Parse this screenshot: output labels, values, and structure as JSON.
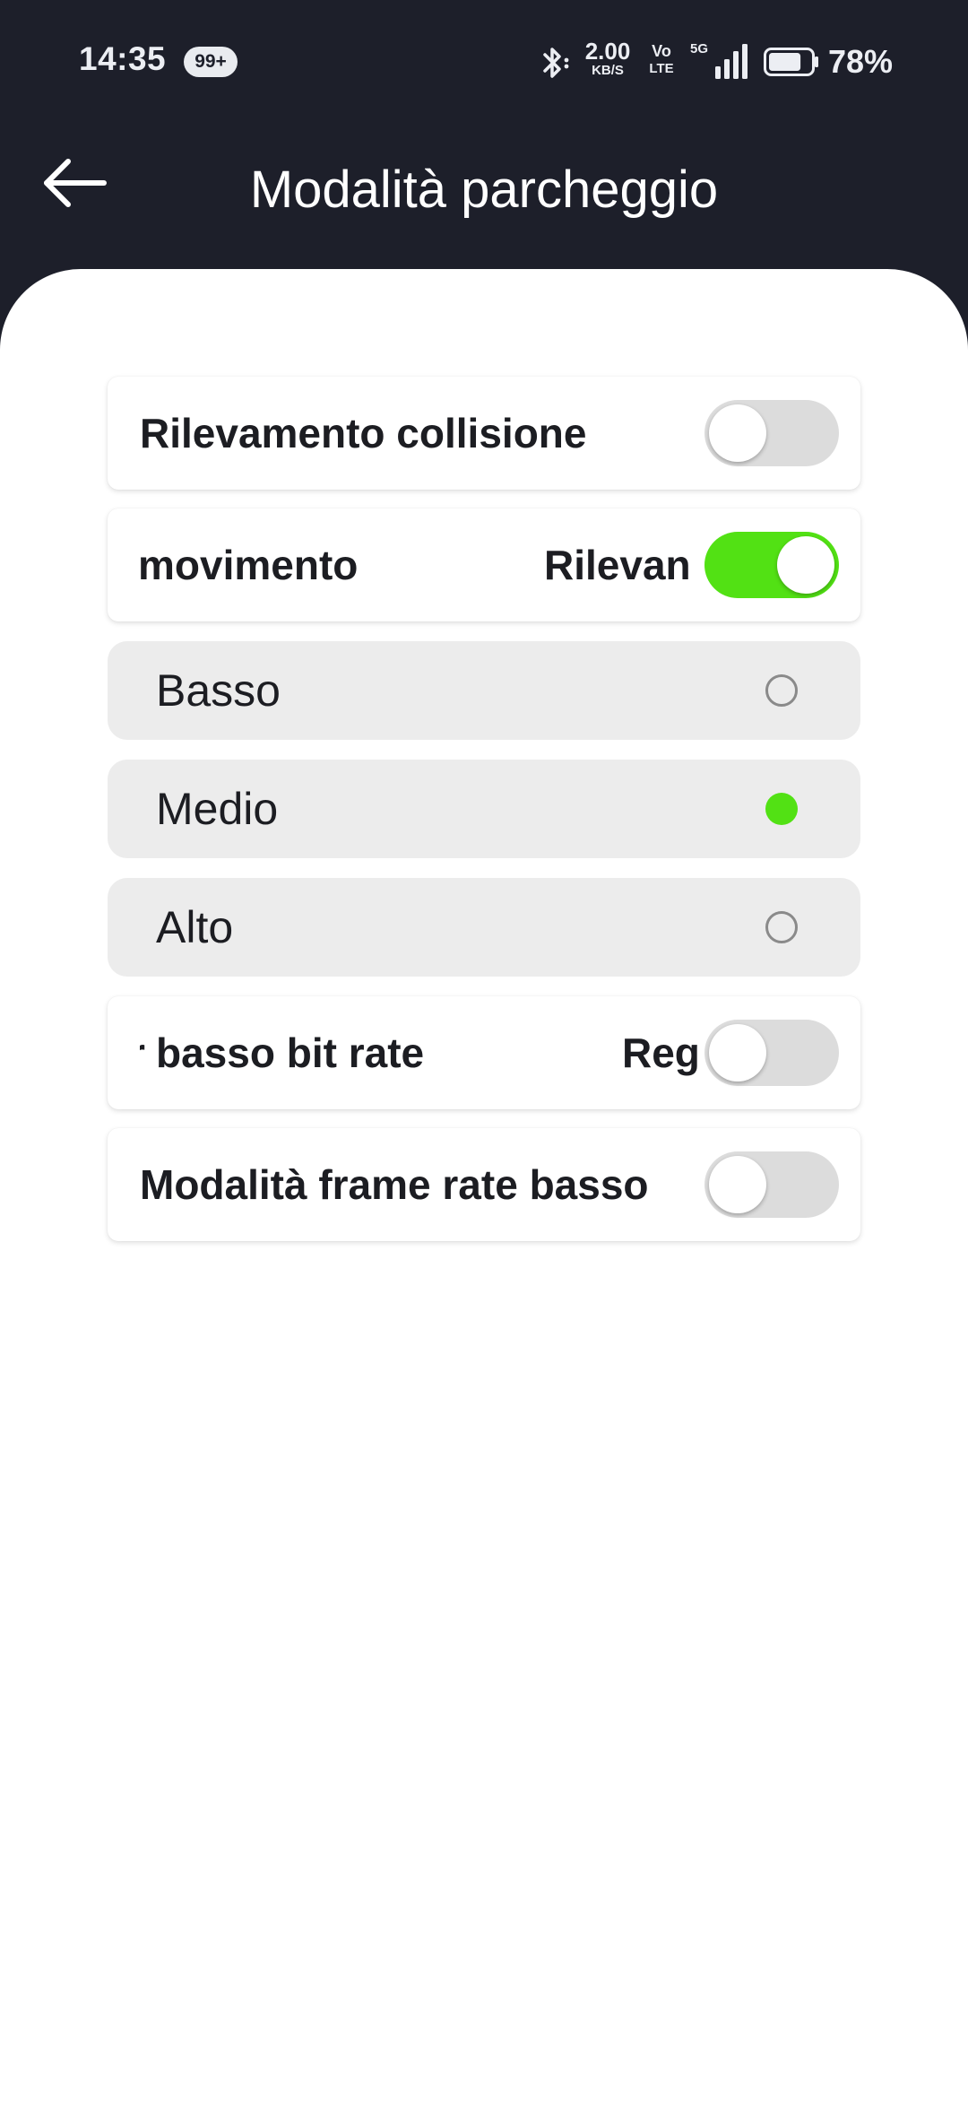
{
  "status_bar": {
    "time": "14:35",
    "notification_badge": "99+",
    "net_speed_value": "2.00",
    "net_speed_unit": "KB/S",
    "volte_top": "Vo",
    "volte_bottom": "LTE",
    "network_type": "5G",
    "battery_percent": "78%",
    "battery_level": 0.78
  },
  "header": {
    "title": "Modalità parcheggio",
    "back_icon": "arrow-left-icon"
  },
  "settings": {
    "collision_detection": {
      "label": "Rilevamento collisione",
      "enabled": false
    },
    "motion_detection": {
      "label_visible_end": "movimento",
      "label_visible_start": "Rilevan",
      "enabled": true
    },
    "sensitivity_options": [
      {
        "label": "Basso",
        "selected": false
      },
      {
        "label": "Medio",
        "selected": true
      },
      {
        "label": "Alto",
        "selected": false
      }
    ],
    "low_bitrate": {
      "label_visible_end": "basso bit rate",
      "label_visible_start": "Reg",
      "enabled": false
    },
    "low_framerate": {
      "label": "Modalità frame rate basso",
      "enabled": false
    }
  },
  "colors": {
    "header_background": "#1d1f2a",
    "accent_green": "#52e114",
    "toggle_off": "#dcdcdc",
    "option_background": "#ececec"
  }
}
